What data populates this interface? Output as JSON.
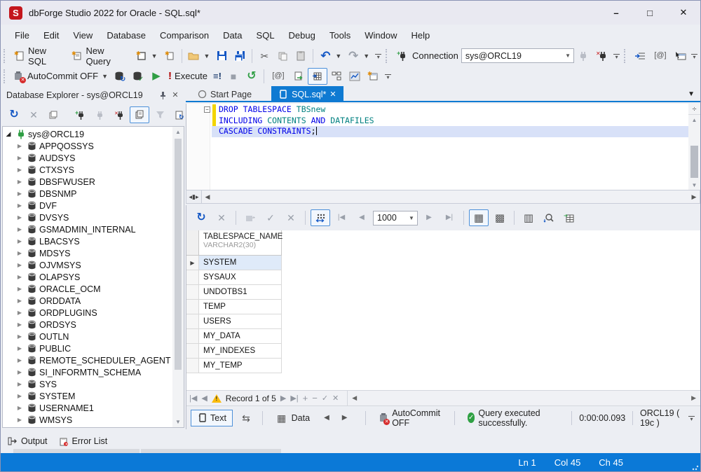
{
  "window": {
    "title": "dbForge Studio 2022 for Oracle - SQL.sql*",
    "logo_letter": "S",
    "controls": {
      "minimize": "–",
      "maximize": "□",
      "close": "✕"
    }
  },
  "menu": {
    "items": [
      "File",
      "Edit",
      "View",
      "Database",
      "Comparison",
      "Data",
      "SQL",
      "Debug",
      "Tools",
      "Window",
      "Help"
    ]
  },
  "toolbar_standard": {
    "new_sql": "New SQL",
    "new_query": "New Query",
    "connection_label": "Connection",
    "connection_value": "sys@ORCL19"
  },
  "toolbar_text": {
    "autocommit": "AutoCommit OFF",
    "execute": "Execute",
    "execute_script": "≡!"
  },
  "explorer": {
    "title": "Database Explorer - sys@ORCL19",
    "root": "sys@ORCL19",
    "schemas": [
      "APPQOSSYS",
      "AUDSYS",
      "CTXSYS",
      "DBSFWUSER",
      "DBSNMP",
      "DVF",
      "DVSYS",
      "GSMADMIN_INTERNAL",
      "LBACSYS",
      "MDSYS",
      "OJVMSYS",
      "OLAPSYS",
      "ORACLE_OCM",
      "ORDDATA",
      "ORDPLUGINS",
      "ORDSYS",
      "OUTLN",
      "PUBLIC",
      "REMOTE_SCHEDULER_AGENT",
      "SI_INFORMTN_SCHEMA",
      "SYS",
      "SYSTEM",
      "USERNAME1",
      "WMSYS"
    ]
  },
  "tabs": {
    "start_page": "Start Page",
    "sql_doc": "SQL.sql*",
    "close_glyph": "✕"
  },
  "editor": {
    "colors": {
      "kw": "#0000e8",
      "id": "#008080",
      "pn": "#000000"
    },
    "code": [
      {
        "current": false,
        "tokens": [
          {
            "text": "DROP TABLESPACE ",
            "type": "kw"
          },
          {
            "text": "TBSnew",
            "type": "id"
          }
        ]
      },
      {
        "current": false,
        "tokens": [
          {
            "text": "INCLUDING ",
            "type": "kw"
          },
          {
            "text": "CONTENTS ",
            "type": "id"
          },
          {
            "text": "AND ",
            "type": "kw"
          },
          {
            "text": "DATAFILES",
            "type": "id"
          }
        ]
      },
      {
        "current": true,
        "tokens": [
          {
            "text": "CASCADE CONSTRAINTS",
            "type": "kw"
          },
          {
            "text": ";",
            "type": "pn"
          }
        ]
      }
    ]
  },
  "results": {
    "page_size": "1000",
    "column_name": "TABLESPACE_NAME",
    "column_type": "VARCHAR2(30)",
    "rows": [
      "SYSTEM",
      "SYSAUX",
      "UNDOTBS1",
      "TEMP",
      "USERS",
      "MY_DATA",
      "MY_INDEXES",
      "MY_TEMP"
    ],
    "selected_row": "SYSTEM",
    "record_status": "Record 1 of 5"
  },
  "doc_statusbar": {
    "text_view": "Text",
    "data_view": "Data",
    "autocommit": "AutoCommit OFF",
    "message": "Query executed successfully.",
    "duration": "0:00:00.093",
    "server": "ORCL19 ( 19c )"
  },
  "bottom_panel": {
    "output": "Output",
    "error_list": "Error List"
  },
  "app_statusbar": {
    "line": "Ln 1",
    "column": "Col 45",
    "char": "Ch 45"
  },
  "icons": {
    "refresh": "↻",
    "history": "↺",
    "undo": "↶",
    "redo": "↷",
    "cut": "✂",
    "close": "✕",
    "play": "▶",
    "stop": "■",
    "check": "✓",
    "plus": "+",
    "minus": "−",
    "grid_view": "▦",
    "card_view": "▩",
    "columns_view": "▥",
    "swap": "⇆",
    "nav_first": "|◀",
    "nav_prev": "◀",
    "nav_next": "▶",
    "nav_last": "▶|",
    "arrow_left": "◀",
    "arrow_right": "▶",
    "arrow_up": "▲",
    "arrow_down": "▼",
    "at_macro": "[@]",
    "splitter": "÷",
    "hsplit": "◂▮▸"
  },
  "accent": {
    "tab_blue": "#0f7ad2",
    "status_blue": "#0b79d7",
    "brand_red": "#c4161c",
    "modified_yellow": "#f3d500",
    "selection": "#dfeaf9"
  }
}
